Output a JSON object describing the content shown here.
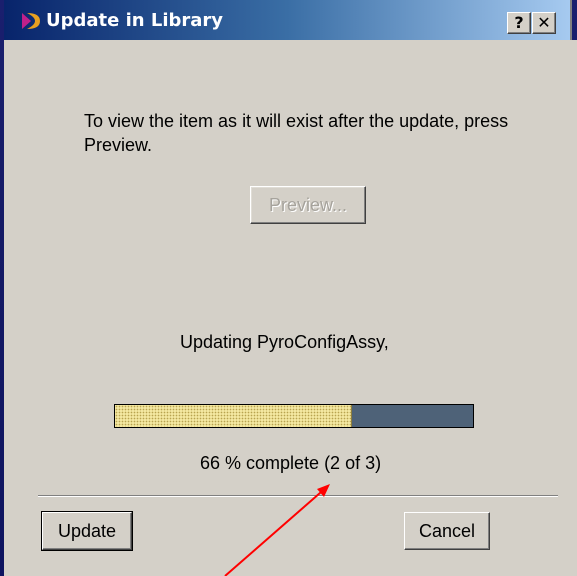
{
  "window": {
    "title": "Update in Library",
    "help_label": "?",
    "close_label": "✕"
  },
  "content": {
    "instructions": "To view the item as it will exist after the update, press Preview.",
    "preview_label": "Preview...",
    "status": "Updating  PyroConfigAssy,",
    "progress_fraction": 0.66,
    "progress_text": "66 % complete (2  of  3)"
  },
  "buttons": {
    "update_label": "Update",
    "cancel_label": "Cancel"
  },
  "colors": {
    "dialog_bg": "#d4d0c8",
    "progress_fill": "#f3e7a0",
    "progress_empty": "#4e6278",
    "annotation_arrow": "#ff0000"
  }
}
